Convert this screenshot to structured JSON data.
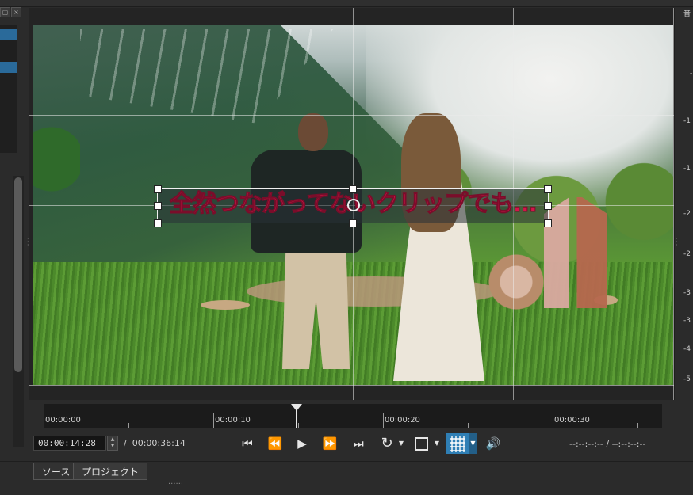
{
  "viewer": {
    "title_overlay_text": "全然つながってないクリップでも…",
    "right_ruler_labels": [
      "音",
      "-",
      "-1",
      "-1",
      "-2",
      "-2",
      "-3",
      "-3",
      "-4",
      "-5"
    ]
  },
  "timeline": {
    "marks": [
      "00:00:00",
      "00:00:10",
      "00:00:20",
      "00:00:30"
    ]
  },
  "transport": {
    "current_timecode": "00:00:14:28",
    "duration_separator": "/",
    "duration": "00:00:36:14",
    "in_out_text": "--:--:--:-- / --:--:--:--",
    "icons": [
      "skip-to-start-icon",
      "rewind-icon",
      "play-icon",
      "fast-forward-icon",
      "skip-to-end-icon",
      "loop-icon",
      "zoom-fit-icon",
      "grid-icon",
      "volume-icon"
    ]
  },
  "tabs": {
    "source_label": "ソース",
    "project_label": "プロジェクト"
  },
  "colors": {
    "accent": "#2f7fb5",
    "title_text": "#d4154a"
  }
}
